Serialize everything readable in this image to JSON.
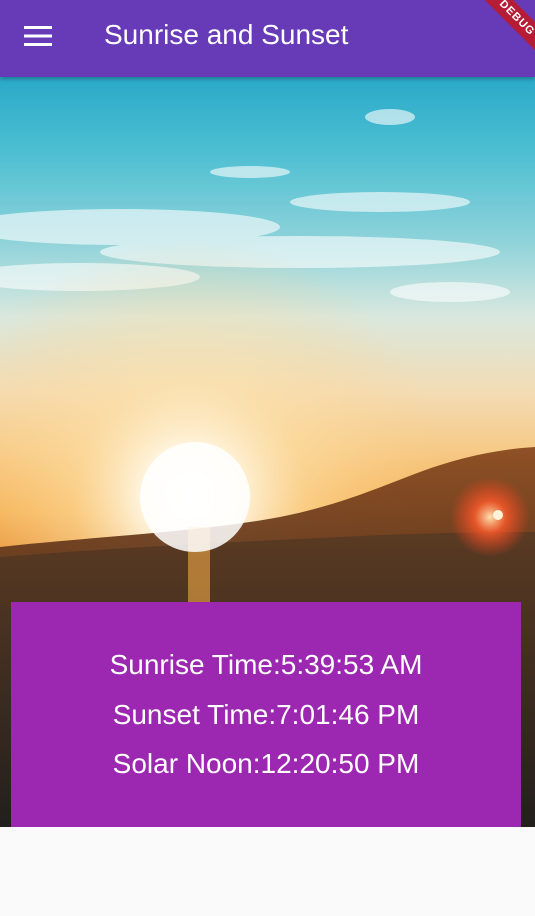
{
  "app_bar": {
    "title": "Sunrise and Sunset",
    "menu_icon": "menu-icon",
    "color": "#673ab7"
  },
  "debug_banner": {
    "label": "DEBUG",
    "color": "#b71c36"
  },
  "scene_image": {
    "subject": "sunrise over hills"
  },
  "info_card": {
    "color": "#9c27b0",
    "sunrise": "Sunrise Time:5:39:53 AM",
    "sunset": "Sunset Time:7:01:46 PM",
    "solar_noon": "Solar Noon:12:20:50 PM"
  }
}
